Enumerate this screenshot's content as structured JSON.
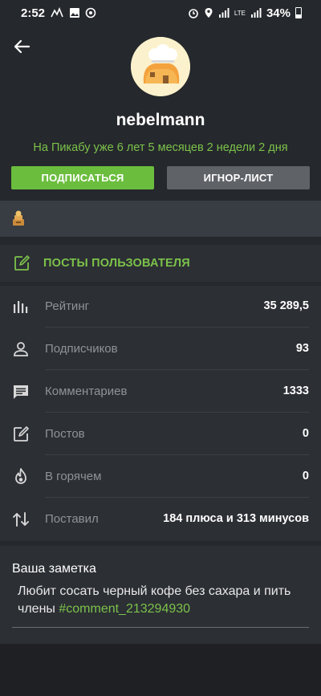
{
  "statusbar": {
    "time": "2:52",
    "battery": "34%",
    "signal_label": "LTE"
  },
  "profile": {
    "username": "nebelmann",
    "since": "На Пикабу уже 6 лет 5 месяцев 2 недели 2 дня"
  },
  "buttons": {
    "subscribe": "ПОДПИСАТЬСЯ",
    "ignore": "ИГНОР-ЛИСТ"
  },
  "posts_link": {
    "label": "ПОСТЫ ПОЛЬЗОВАТЕЛЯ"
  },
  "stats": [
    {
      "icon": "bar-chart-icon",
      "label": "Рейтинг",
      "value": "35 289,5"
    },
    {
      "icon": "person-icon",
      "label": "Подписчиков",
      "value": "93"
    },
    {
      "icon": "comment-icon",
      "label": "Комментариев",
      "value": "1333"
    },
    {
      "icon": "edit-icon",
      "label": "Постов",
      "value": "0"
    },
    {
      "icon": "flame-icon",
      "label": "В горячем",
      "value": "0"
    },
    {
      "icon": "up-down-arrows-icon",
      "label": "Поставил",
      "value": "184 плюса и 313 минусов"
    }
  ],
  "note": {
    "title": "Ваша заметка",
    "text": "Любит сосать черный кофе без сахара и пить члены ",
    "tag": "#comment_213294930"
  },
  "colors": {
    "accent": "#6bbd3e",
    "accent_text": "#7cc24a",
    "background": "#25282c",
    "card": "#2c2f34"
  }
}
